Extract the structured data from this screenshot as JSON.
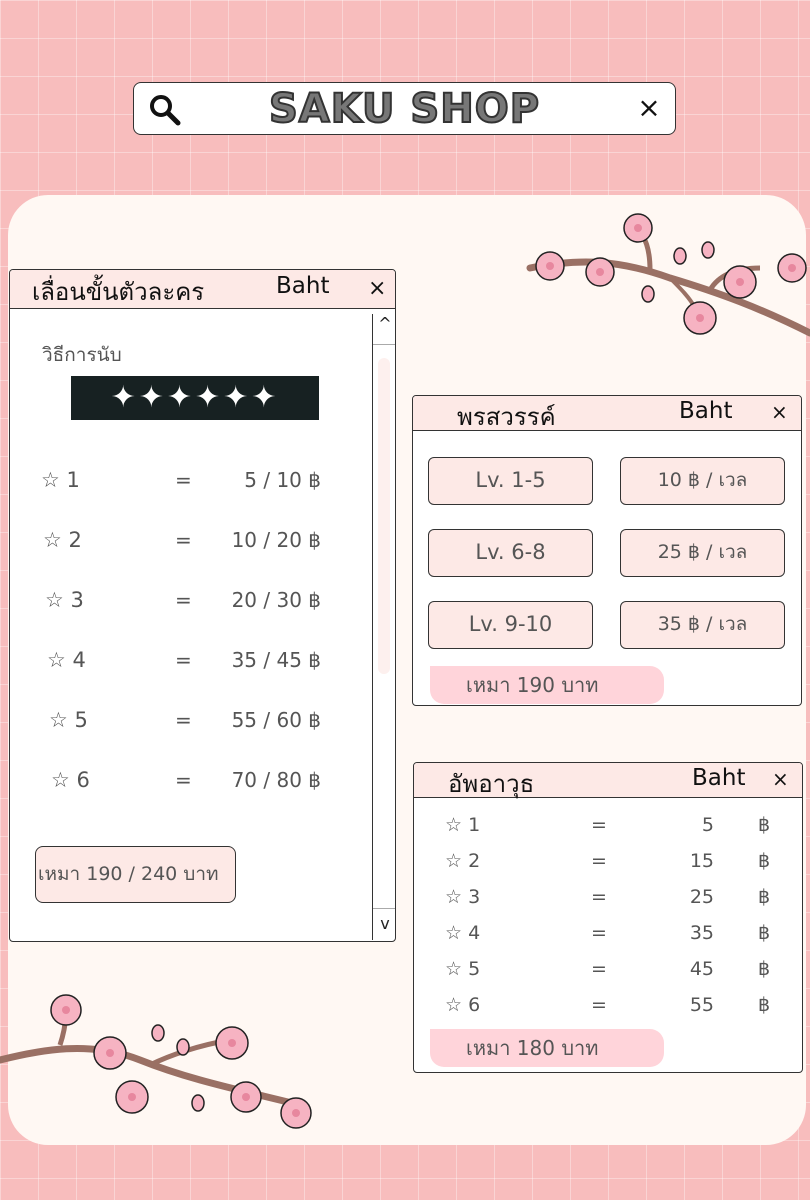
{
  "header": {
    "shop_name": "SAKU SHOP",
    "search_icon": "search-icon",
    "close_icon": "close-icon",
    "close_glyph": "×"
  },
  "colors": {
    "background": "#f8bdbd",
    "card": "#fff8f3",
    "panel_header": "#fde9e6",
    "bubble": "#ffd4da",
    "blossom": "#f6b3c2",
    "branch": "#9a7064"
  },
  "leveling_panel": {
    "title": "เลื่อนขั้นตัวละคร",
    "currency": "Baht",
    "close": "×",
    "method_label": "วิธีการนับ",
    "stars_display": "✦✦✦✦✦✦",
    "rows": [
      {
        "star": "☆ 1",
        "eq": "=",
        "price": "5 / 10 ฿"
      },
      {
        "star": "☆ 2",
        "eq": "=",
        "price": "10 / 20 ฿"
      },
      {
        "star": "☆ 3",
        "eq": "=",
        "price": "20 / 30 ฿"
      },
      {
        "star": "☆ 4",
        "eq": "=",
        "price": "35 / 45 ฿"
      },
      {
        "star": "☆ 5",
        "eq": "=",
        "price": "55 / 60 ฿"
      },
      {
        "star": "☆ 6",
        "eq": "=",
        "price": "70 / 80 ฿"
      }
    ],
    "bundle_label": "เหมา  190 / 240  บาท",
    "scroll_up": "^",
    "scroll_down": "v"
  },
  "talent_panel": {
    "title": "พรสวรรค์",
    "currency": "Baht",
    "close": "×",
    "rows": [
      {
        "level": "Lv. 1-5",
        "price": "10 ฿ / เวล"
      },
      {
        "level": "Lv. 6-8",
        "price": "25 ฿ / เวล"
      },
      {
        "level": "Lv. 9-10",
        "price": "35 ฿ / เวล"
      }
    ],
    "bundle_label": "เหมา  190  บาท"
  },
  "weapon_panel": {
    "title": "อัพอาวุธ",
    "currency": "Baht",
    "close": "×",
    "rows": [
      {
        "star": "☆ 1",
        "eq": "=",
        "price": "5",
        "unit": "฿"
      },
      {
        "star": "☆ 2",
        "eq": "=",
        "price": "15",
        "unit": "฿"
      },
      {
        "star": "☆ 3",
        "eq": "=",
        "price": "25",
        "unit": "฿"
      },
      {
        "star": "☆ 4",
        "eq": "=",
        "price": "35",
        "unit": "฿"
      },
      {
        "star": "☆ 5",
        "eq": "=",
        "price": "45",
        "unit": "฿"
      },
      {
        "star": "☆ 6",
        "eq": "=",
        "price": "55",
        "unit": "฿"
      }
    ],
    "bundle_label": "เหมา  180  บาท"
  }
}
